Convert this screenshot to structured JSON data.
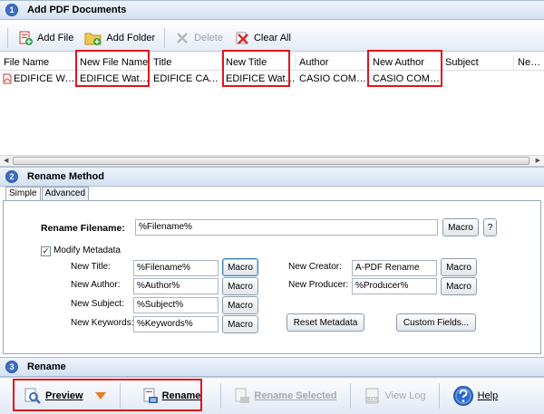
{
  "sections": {
    "add": {
      "num": "1",
      "title": "Add PDF Documents"
    },
    "rename_method": {
      "num": "2",
      "title": "Rename Method"
    },
    "rename": {
      "num": "3",
      "title": "Rename"
    }
  },
  "toolbar": {
    "add_file": "Add File",
    "add_folder": "Add Folder",
    "delete": "Delete",
    "clear_all": "Clear All"
  },
  "grid": {
    "columns": [
      "File Name",
      "New File Name",
      "Title",
      "New Title",
      "Author",
      "New Author",
      "Subject",
      "New Su"
    ],
    "rows": [
      [
        "EDIFICE Wat...",
        "EDIFICE Watch...",
        "EDIFICE CATAL...",
        "EDIFICE Watch...",
        "CASIO COMPU...",
        "CASIO COMPU...",
        "",
        ""
      ]
    ]
  },
  "tabs": [
    "Simple",
    "Advanced"
  ],
  "form": {
    "rename_filename_label": "Rename Filename:",
    "rename_filename_value": "%Filename%",
    "macro": "Macro",
    "help_q": "?",
    "modify_metadata_label": "Modify Metadata",
    "modify_metadata_checked": "✓",
    "new_title_label": "New Title:",
    "new_title_value": "%Filename%",
    "new_author_label": "New Author:",
    "new_author_value": "%Author%",
    "new_subject_label": "New Subject:",
    "new_subject_value": "%Subject%",
    "new_keywords_label": "New Keywords:",
    "new_keywords_value": "%Keywords%",
    "new_creator_label": "New Creator:",
    "new_creator_value": "A-PDF Rename",
    "new_producer_label": "New Producer:",
    "new_producer_value": "%Producer%",
    "reset_metadata": "Reset Metadata",
    "custom_fields": "Custom Fields..."
  },
  "bottom": {
    "preview": "Preview",
    "rename": "Rename",
    "rename_selected": "Rename Selected",
    "view_log": "View Log",
    "help": "Help",
    "log_icon_text": "LOG"
  },
  "colors": {
    "accent": "#3d6fc4",
    "highlight_box": "#e0141d"
  }
}
